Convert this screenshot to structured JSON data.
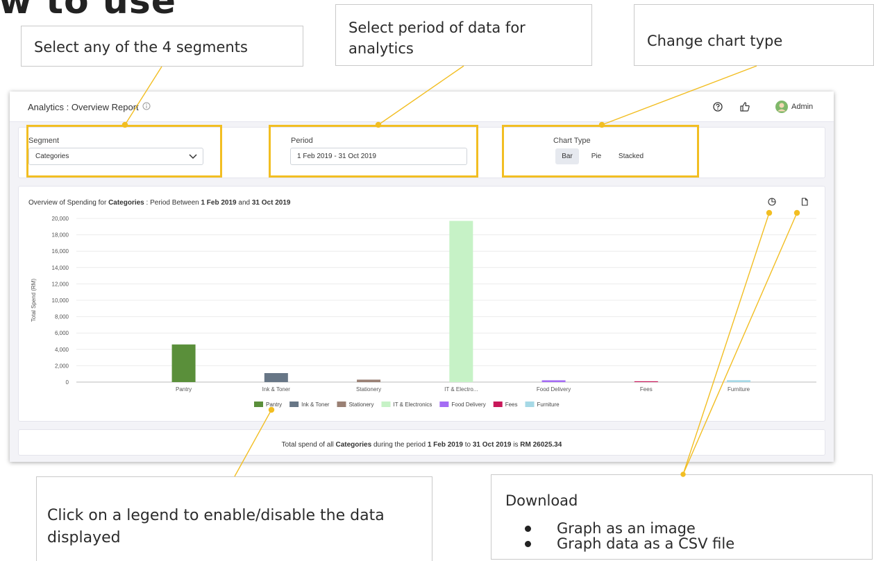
{
  "slide": {
    "heading": "w to use"
  },
  "callouts": {
    "segment": "Select any of the 4 segments",
    "period": "Select period of data for analytics",
    "chart_type": "Change chart type",
    "legend": "Click on a legend to enable/disable the data displayed",
    "download": {
      "title": "Download",
      "items": [
        "Graph as an image",
        "Graph data as a CSV file"
      ]
    }
  },
  "app": {
    "title": "Analytics : Overview Report",
    "user": "Admin",
    "icons": [
      "info-icon",
      "help-icon",
      "thumbs-up-icon",
      "avatar",
      "pie-download-icon",
      "csv-file-icon",
      "chevron-down-icon"
    ]
  },
  "filters": {
    "segment_label": "Segment",
    "segment_value": "Categories",
    "period_label": "Period",
    "period_value": "1 Feb 2019 - 31 Oct 2019",
    "chart_type_label": "Chart Type",
    "chart_types": [
      "Bar",
      "Pie",
      "Stacked"
    ],
    "selected_chart_type": "Bar"
  },
  "chart_header": {
    "prefix": "Overview of Spending for ",
    "segment": "Categories",
    "middle": " : Period Between ",
    "start": "1 Feb 2019",
    "and": " and ",
    "end": "31 Oct 2019"
  },
  "chart_data": {
    "type": "bar",
    "title": "",
    "xlabel": "",
    "ylabel": "Total Spend (RM)",
    "ylim": [
      0,
      20000
    ],
    "yticks": [
      "0",
      "2,000",
      "4,000",
      "6,000",
      "8,000",
      "10,000",
      "12,000",
      "14,000",
      "16,000",
      "18,000",
      "20,000"
    ],
    "grid": true,
    "legend_position": "bottom",
    "categories": [
      "Pantry",
      "Ink & Toner",
      "Stationery",
      "IT & Electro...",
      "Food Delivery",
      "Fees",
      "Furniture"
    ],
    "legend": [
      "Pantry",
      "Ink & Toner",
      "Stationery",
      "IT & Electronics",
      "Food Delivery",
      "Fees",
      "Furniture"
    ],
    "values": [
      4600,
      1100,
      300,
      19700,
      220,
      100,
      230
    ],
    "colors": [
      "#5a8f3a",
      "#677686",
      "#9a8074",
      "#c6f2c6",
      "#a46cf4",
      "#c8185a",
      "#a6d9e6"
    ]
  },
  "summary": {
    "prefix": "Total spend of all ",
    "segment": "Categories",
    "middle": " during the period ",
    "start": "1 Feb 2019",
    "to": " to ",
    "end": "31 Oct 2019",
    "is": " is ",
    "amount": "RM 26025.34"
  },
  "colors": {
    "highlight": "#f2be22",
    "connector": "#f2be22"
  }
}
